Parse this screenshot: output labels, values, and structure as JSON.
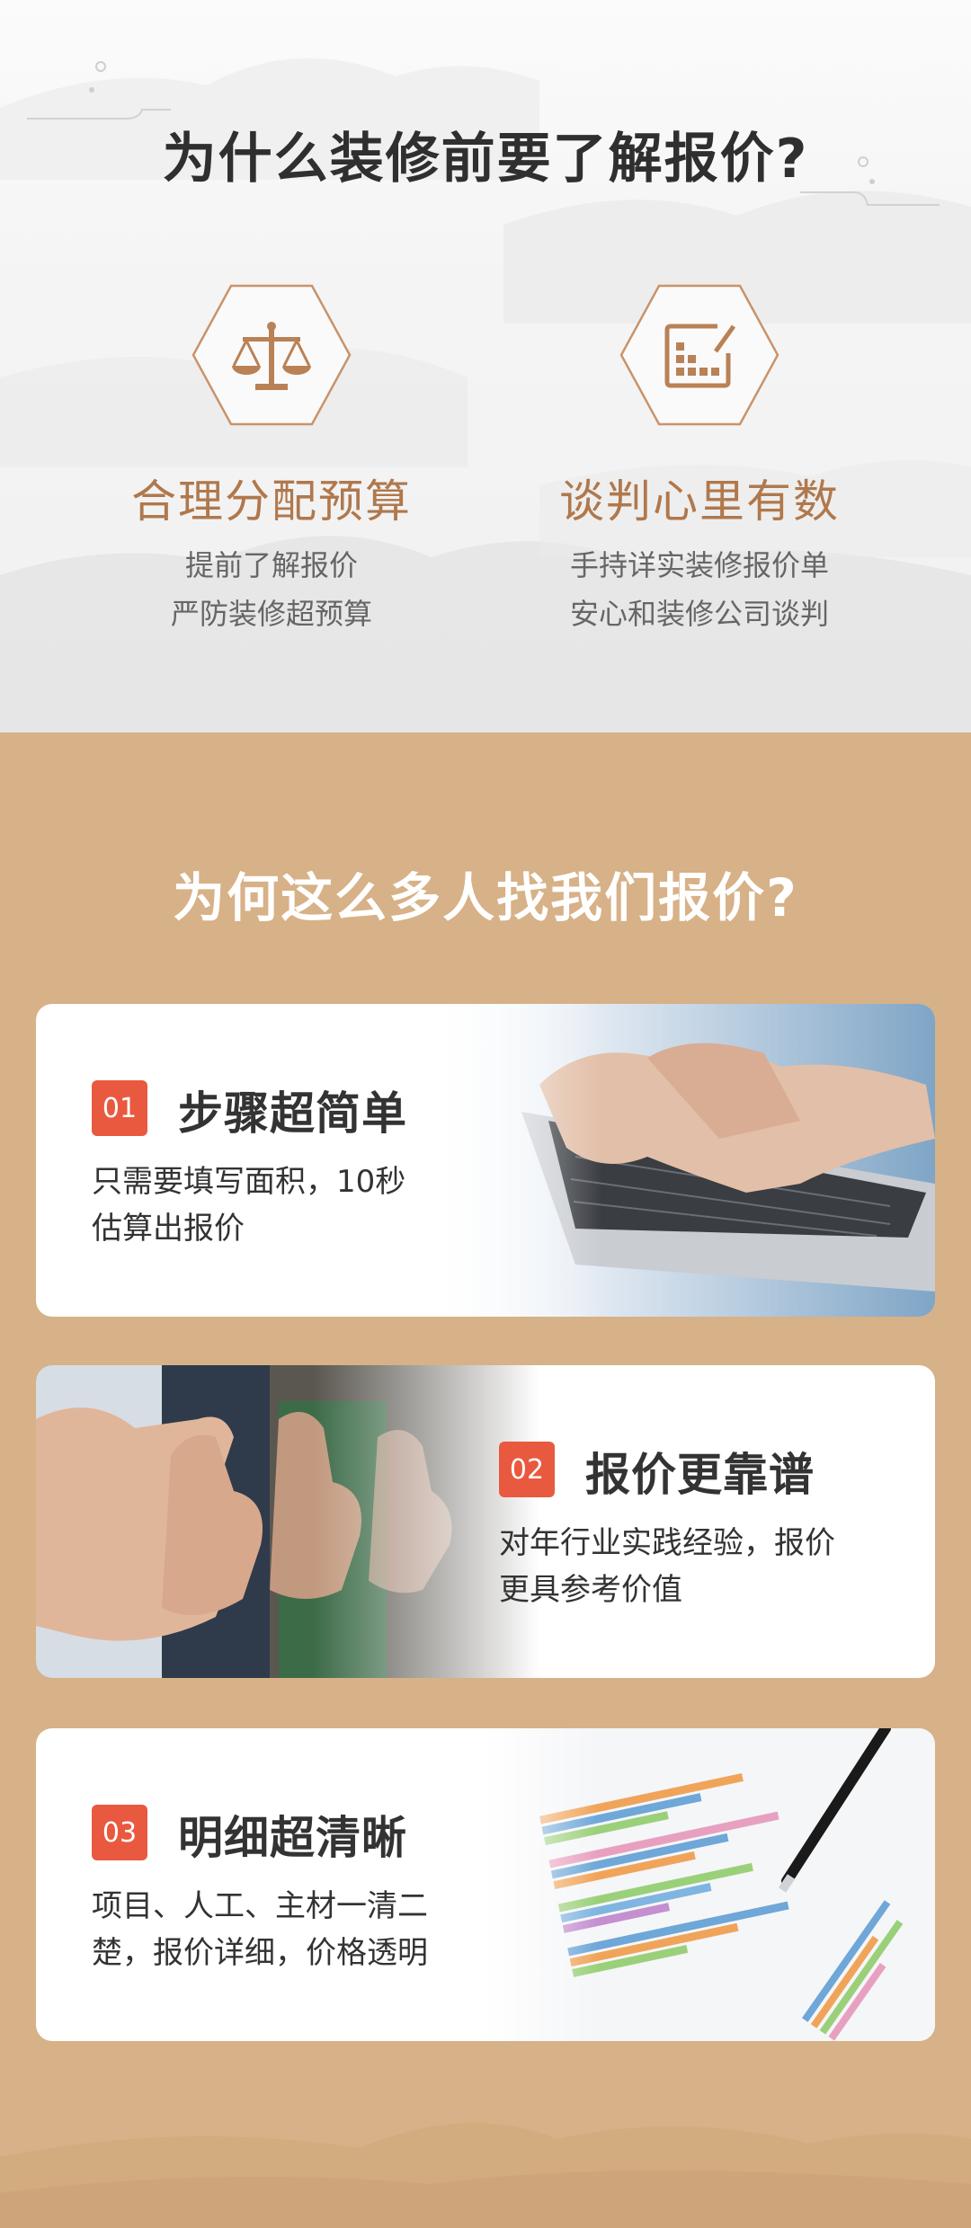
{
  "section1": {
    "title": "为什么装修前要了解报价?",
    "features": [
      {
        "icon": "scale-icon",
        "title": "合理分配预算",
        "lines": [
          "提前了解报价",
          "严防装修超预算"
        ]
      },
      {
        "icon": "calculator-note-icon",
        "title": "谈判心里有数",
        "lines": [
          "手持详实装修报价单",
          "安心和装修公司谈判"
        ]
      }
    ]
  },
  "section2": {
    "title": "为何这么多人找我们报价?",
    "cards": [
      {
        "number": "01",
        "title": "步骤超简单",
        "lines": [
          "只需要填写面积，10秒",
          "估算出报价"
        ],
        "image": "laptop-typing-image"
      },
      {
        "number": "02",
        "title": "报价更靠谱",
        "lines": [
          "对年行业实践经验，报价",
          "更具参考价值"
        ],
        "image": "thumbs-up-image"
      },
      {
        "number": "03",
        "title": "明细超清晰",
        "lines": [
          "项目、人工、主材一清二",
          "楚，报价详细，价格透明"
        ],
        "image": "bar-chart-pen-image"
      }
    ]
  },
  "colors": {
    "accent_brown": "#b0784c",
    "background_tan": "#d7b187",
    "badge_red": "#e9593f",
    "title_dark": "#2f2f2f"
  }
}
